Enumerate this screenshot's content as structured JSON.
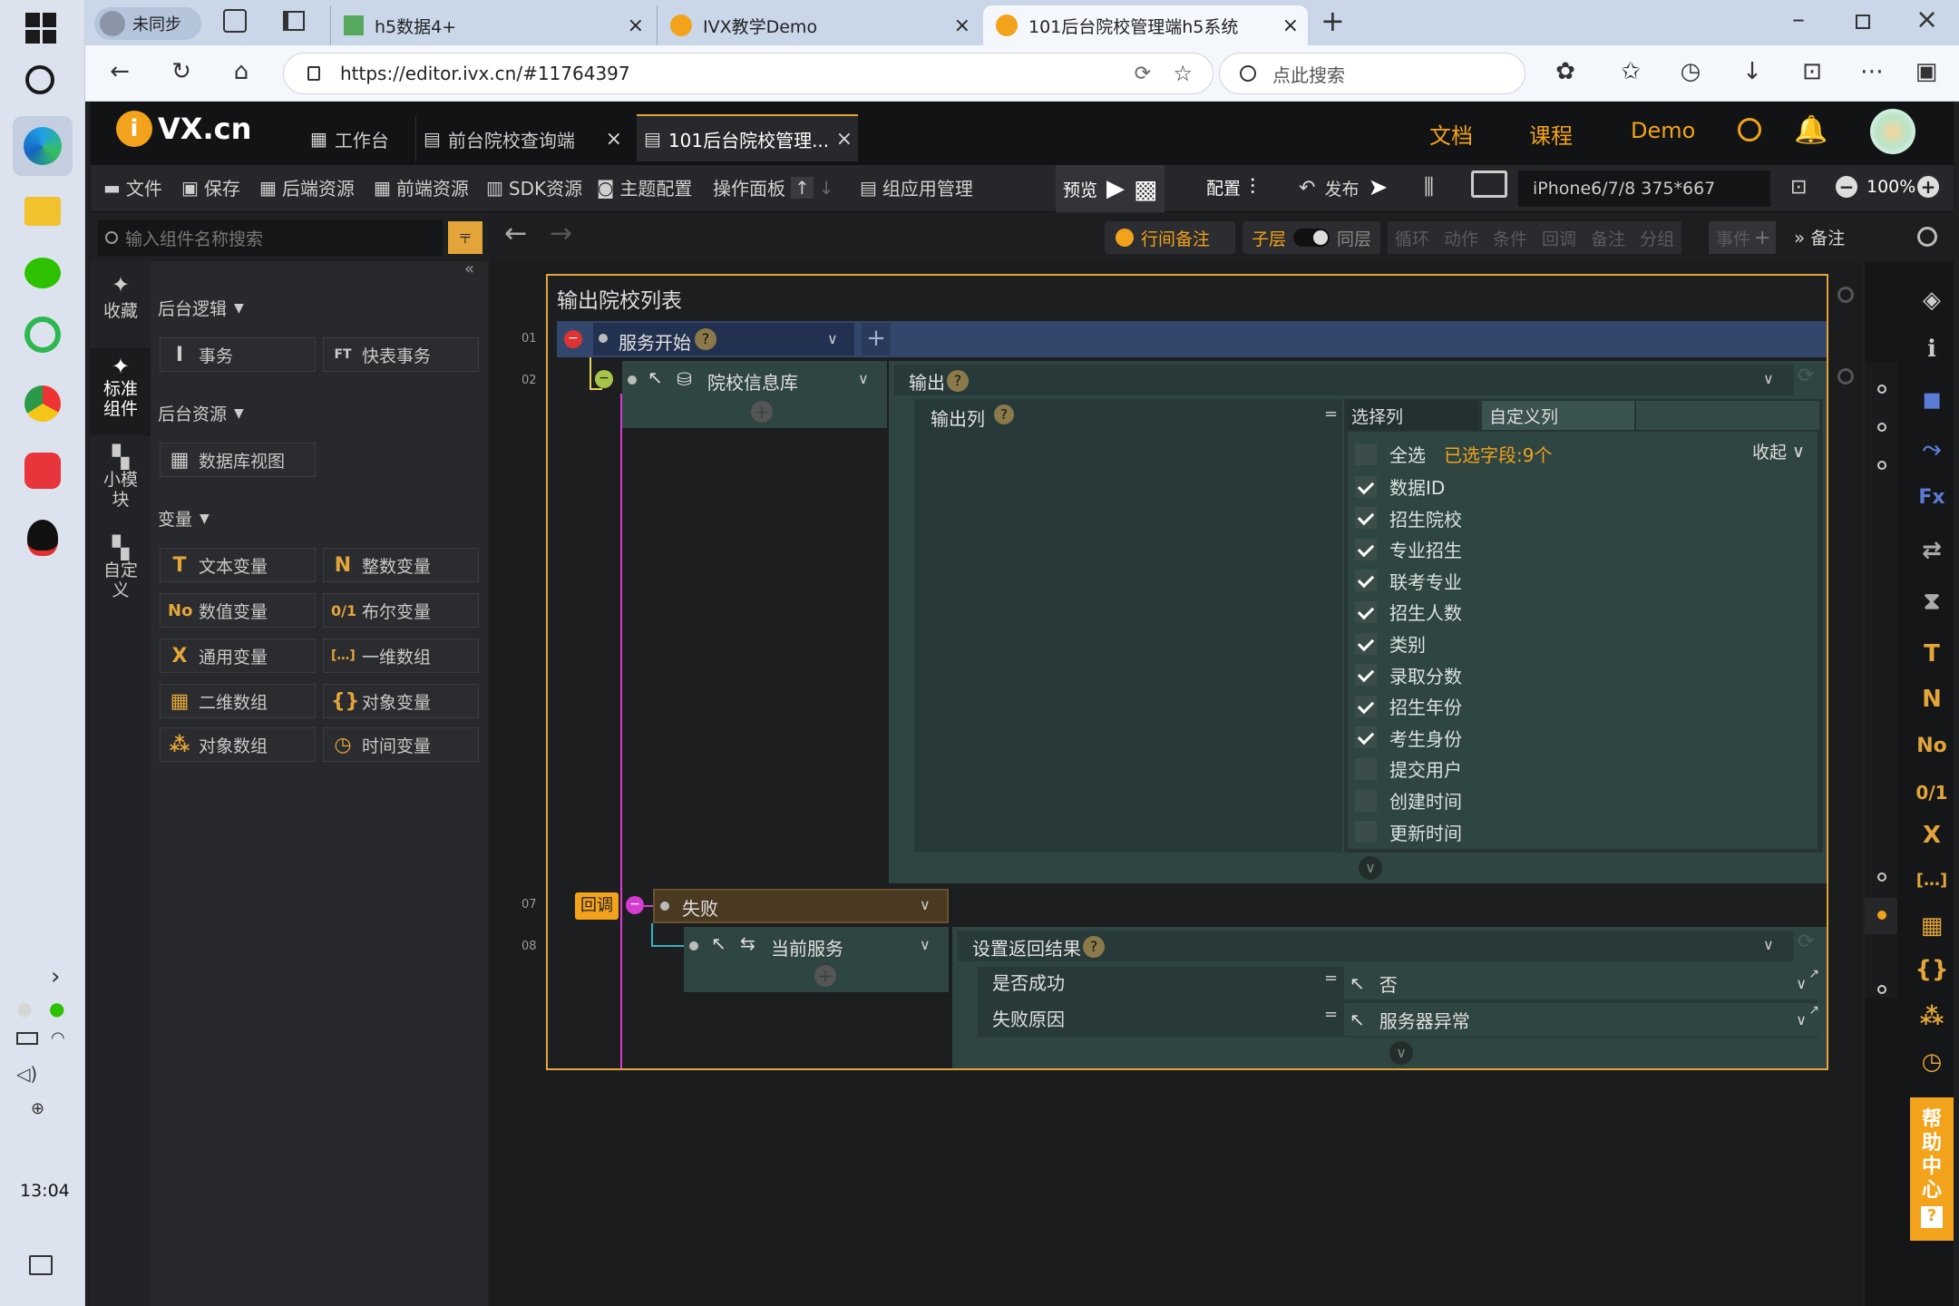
{
  "taskbar": {
    "time": "13:04"
  },
  "browser": {
    "profile": "未同步",
    "tabs": [
      {
        "label": "h5数据4+"
      },
      {
        "label": "IVX教学Demo"
      },
      {
        "label": "101后台院校管理端h5系统"
      }
    ],
    "url": "https://editor.ivx.cn/#11764397",
    "search_placeholder": "点此搜索"
  },
  "app": {
    "logo": "VX.cn",
    "tabs": [
      {
        "label": "工作台"
      },
      {
        "label": "前台院校查询端"
      },
      {
        "label": "101后台院校管理..."
      }
    ],
    "nav": {
      "docs": "文档",
      "courses": "课程",
      "demo": "Demo"
    },
    "toolbar": {
      "file": "文件",
      "save": "保存",
      "backend": "后端资源",
      "frontend": "前端资源",
      "sdk": "SDK资源",
      "theme": "主题配置",
      "panel": "操作面板",
      "group": "组应用管理",
      "preview": "预览",
      "config": "配置",
      "publish": "发布",
      "device": "iPhone6/7/8 375*667",
      "zoom": "100%"
    },
    "subbar": {
      "row_note": "行间备注",
      "child": "子层",
      "same": "同层",
      "loop": "循环",
      "action": "动作",
      "cond": "条件",
      "callback": "回调",
      "note": "备注",
      "group": "分组",
      "event": "事件",
      "remark": "备注"
    }
  },
  "left": {
    "rail": [
      {
        "label": "收藏"
      },
      {
        "label": "标准组件"
      },
      {
        "label": "小模块"
      },
      {
        "label": "自定义"
      }
    ],
    "search_placeholder": "输入组件名称搜索",
    "sec_logic": "后台逻辑",
    "logic": [
      {
        "label": "事务",
        "glyph": "I"
      },
      {
        "label": "快表事务",
        "glyph": "FT"
      }
    ],
    "sec_res": "后台资源",
    "res": [
      {
        "label": "数据库视图",
        "glyph": "▦"
      }
    ],
    "sec_var": "变量",
    "vars": [
      {
        "label": "文本变量",
        "glyph": "T"
      },
      {
        "label": "整数变量",
        "glyph": "N"
      },
      {
        "label": "数值变量",
        "glyph": "No"
      },
      {
        "label": "布尔变量",
        "glyph": "0/1"
      },
      {
        "label": "通用变量",
        "glyph": "X"
      },
      {
        "label": "一维数组",
        "glyph": "[…]"
      },
      {
        "label": "二维数组",
        "glyph": "▦"
      },
      {
        "label": "对象变量",
        "glyph": "{}"
      },
      {
        "label": "对象数组",
        "glyph": "⁂"
      },
      {
        "label": "时间变量",
        "glyph": "◷"
      }
    ]
  },
  "canvas": {
    "title": "输出院校列表",
    "n01": "01",
    "n02": "02",
    "n07": "07",
    "n08": "08",
    "service_start": "服务开始",
    "db": "院校信息库",
    "output": "输出",
    "output_cols": "输出列",
    "select_col": "选择列",
    "custom_col": "自定义列",
    "select_all": "全选",
    "selected": "已选字段:9个",
    "collapse": "收起",
    "fields": [
      {
        "label": "数据ID",
        "on": true
      },
      {
        "label": "招生院校",
        "on": true
      },
      {
        "label": "专业招生",
        "on": true
      },
      {
        "label": "联考专业",
        "on": true
      },
      {
        "label": "招生人数",
        "on": true
      },
      {
        "label": "类别",
        "on": true
      },
      {
        "label": "录取分数",
        "on": true
      },
      {
        "label": "招生年份",
        "on": true
      },
      {
        "label": "考生身份",
        "on": true
      },
      {
        "label": "提交用户",
        "on": false
      },
      {
        "label": "创建时间",
        "on": false
      },
      {
        "label": "更新时间",
        "on": false
      }
    ],
    "callback": "回调",
    "fail": "失败",
    "current_service": "当前服务",
    "set_result": "设置返回结果",
    "success_label": "是否成功",
    "success_val": "否",
    "reason_label": "失败原因",
    "reason_val": "服务器异常"
  },
  "help": "帮助中心",
  "colors": {
    "accent": "#e3a53a",
    "panel_teal": "#2f4542",
    "service_bar": "#33466b",
    "fail_bar": "#4b3a22"
  }
}
